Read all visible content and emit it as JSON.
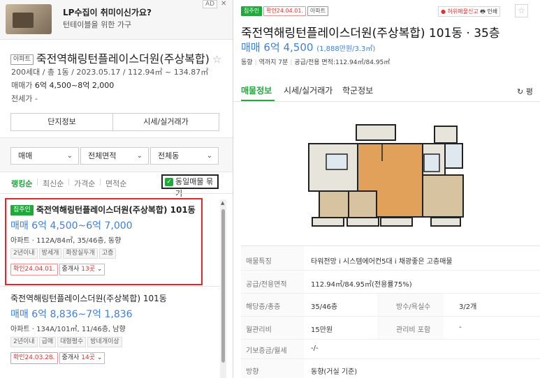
{
  "ad": {
    "title": "LP수집이 취미이신가요?",
    "subtitle": "턴테이블을 위한 가구",
    "badge": "AD",
    "close": "✕"
  },
  "complex": {
    "type_tag": "아파트",
    "name": "죽전역해링턴플레이스더원(주상복합)",
    "star": "☆",
    "info": "200세대 / 총 1동 / 2023.05.17 / 112.94㎡ ~ 134.87㎡",
    "price_label": "매매가",
    "price_value": "6억 4,500~8억 2,000",
    "jeonse": "전세가 -",
    "btn_info": "단지정보",
    "btn_trade": "시세/실거래가"
  },
  "filters": {
    "trade": "매매",
    "area": "전체면적",
    "dong": "전체동",
    "chevron": "⌄"
  },
  "sort": {
    "ranking": "랭킹순",
    "newest": "최신순",
    "price": "가격순",
    "area": "면적순",
    "same_listing": "동일매물 묶기",
    "check": "✓"
  },
  "listings": [
    {
      "tag": "집주인",
      "title": "죽전역해링턴플레이스더원(주상복합) 101동",
      "price": "매매 6억 4,500~6억 7,000",
      "info": "아파트 · 112A/84㎡, 35/46층, 동향",
      "tags": [
        "2년이내",
        "방세개",
        "화장실두개",
        "고층"
      ],
      "confirm": "확인24.04.01.",
      "agent_label": "중개사",
      "agent_count": "13곳",
      "chevron": "⌄"
    },
    {
      "title": "죽전역해링턴플레이스더원(주상복합) 101동",
      "price": "매매 6억 8,836~7억 1,836",
      "info": "아파트 · 134A/101㎡, 11/46층, 남향",
      "tags": [
        "2년이내",
        "급매",
        "대형평수",
        "방네개이상"
      ],
      "confirm": "확인24.03.28.",
      "agent_label": "중개사",
      "agent_count": "14곳",
      "chevron": "⌄"
    }
  ],
  "detail": {
    "tag_owner": "집주인",
    "tag_confirm": "확인24.04.01.",
    "tag_type": "아파트",
    "report": "● 허위매물신고",
    "print": "🖶 인쇄",
    "star": "☆",
    "title": "죽전역해링턴플레이스더원(주상복합) 101동 · 35층",
    "price": "매매 6억 4,500",
    "price_sub": "(1,888만원/3.3㎡)",
    "info": [
      "동향",
      "역까지 7분",
      "공급/전용 면적:112.94㎡/84.95㎡"
    ],
    "tabs": [
      "매물정보",
      "시세/실거래가",
      "학군정보"
    ],
    "refresh": "↻ 평",
    "rows": [
      {
        "k": "매물특징",
        "v": "타워전망 i 시스템에어컨5대 i 채광좋은 고층매물"
      },
      {
        "k": "공급/전용면적",
        "v": "112.94㎡/84.95㎡(전용률75%)"
      },
      {
        "k": "해당층/총층",
        "v": "35/46층",
        "k2": "방수/욕실수",
        "v2": "3/2개"
      },
      {
        "k": "월관리비",
        "v": "15만원",
        "k2": "관리비 포함",
        "v2": "-"
      },
      {
        "k": "기보증금/월세",
        "v": "-/-"
      },
      {
        "k": "방향",
        "v": "동향(거실 기준)"
      }
    ]
  },
  "colors": {
    "green": "#1ea93a",
    "blue_price": "#3f7fd8",
    "red_box": "#e8232a"
  }
}
